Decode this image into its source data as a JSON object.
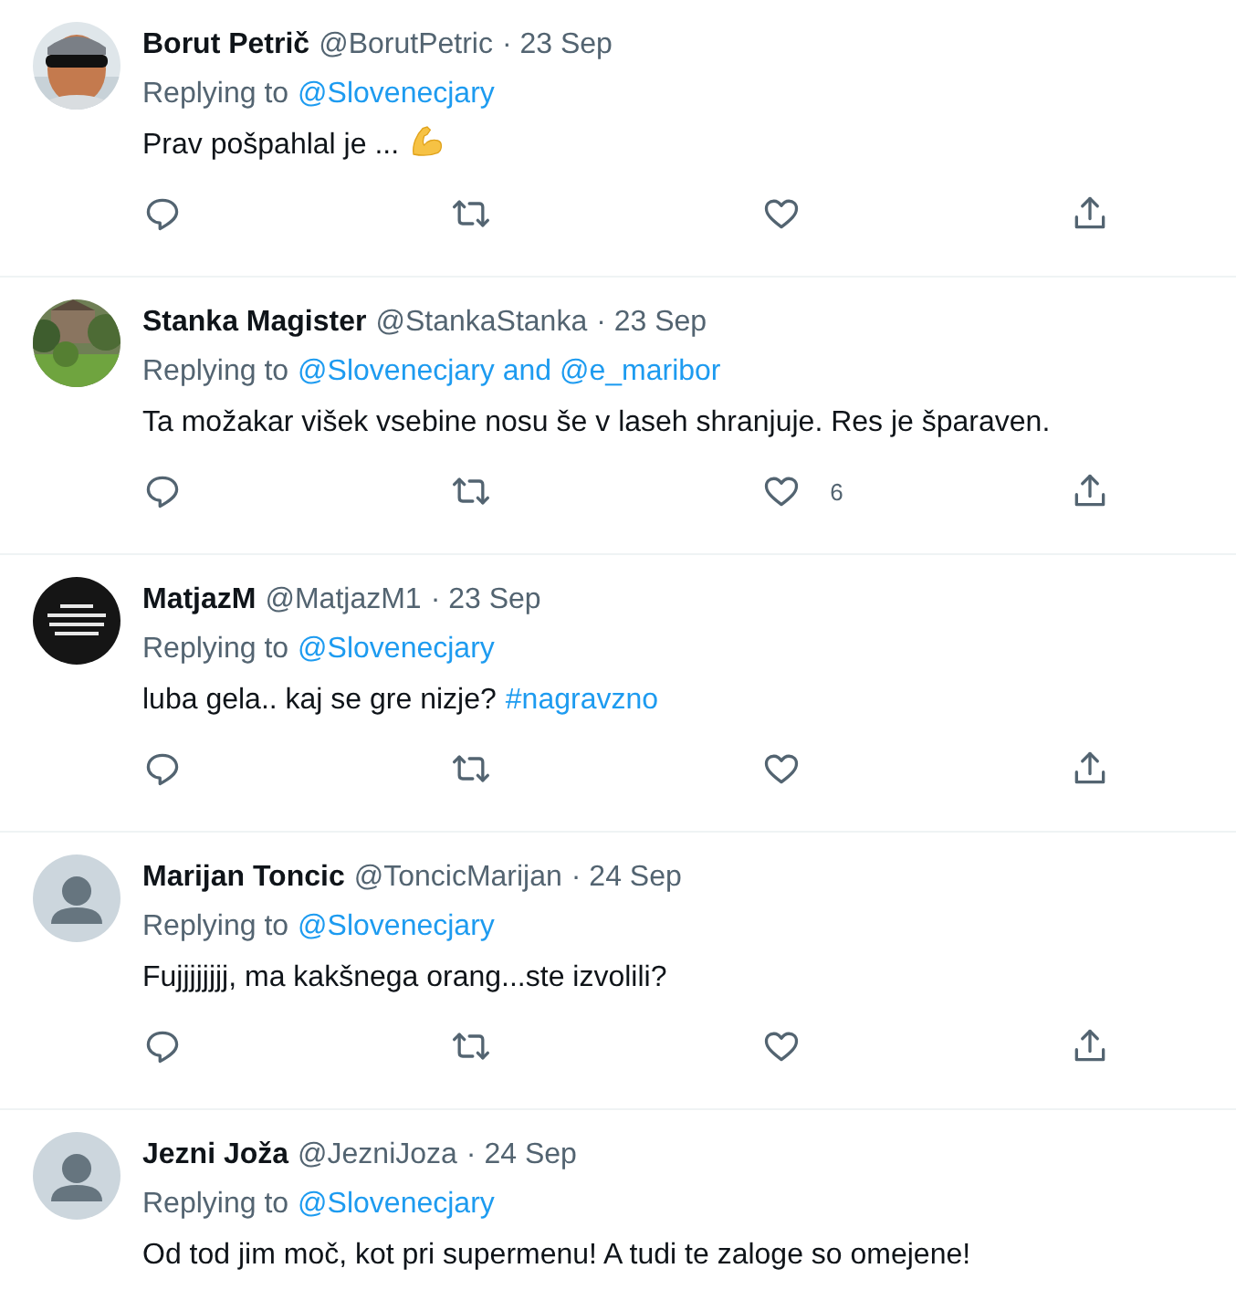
{
  "tweets": [
    {
      "avatar": {
        "kind": "photo-person"
      },
      "name": "Borut Petrič",
      "handle": "@BorutPetric",
      "date": "· 23 Sep",
      "replying_prefix": "Replying to",
      "replying_to": "@Slovenecjary",
      "body": [
        {
          "kind": "text",
          "text": "Prav pošpahlal je ..."
        },
        {
          "kind": "arm-emoji"
        }
      ],
      "actions_shown": true
    },
    {
      "avatar": {
        "kind": "photo-garden"
      },
      "name": "Stanka Magister",
      "handle": "@StankaStanka",
      "date": "· 23 Sep",
      "replying_prefix": "Replying to",
      "replying_to": "@Slovenecjary and @e_maribor",
      "body": [
        {
          "kind": "text",
          "text": "Ta možakar višek vsebine nosu še v laseh shranjuje. Res je šparaven."
        }
      ],
      "likes": "6",
      "actions_shown": true
    },
    {
      "avatar": {
        "kind": "photo-dark"
      },
      "name": "MatjazM",
      "handle": "@MatjazM1",
      "date": "· 23 Sep",
      "replying_prefix": "Replying to",
      "replying_to": "@Slovenecjary",
      "body": [
        {
          "kind": "text",
          "text": "luba gela.. kaj se gre nizje?"
        },
        {
          "kind": "hashtag",
          "text": "#nagravzno"
        }
      ],
      "actions_shown": true
    },
    {
      "avatar": {
        "kind": "default"
      },
      "name": "Marijan Toncic",
      "handle": "@ToncicMarijan",
      "date": "· 24 Sep",
      "replying_prefix": "Replying to",
      "replying_to": "@Slovenecjary",
      "body": [
        {
          "kind": "text",
          "text": "Fujjjjjjjj, ma kakšnega orang...ste izvolili?"
        }
      ],
      "actions_shown": true
    },
    {
      "avatar": {
        "kind": "default"
      },
      "name": "Jezni Joža",
      "handle": "@JezniJoza",
      "date": "· 24 Sep",
      "replying_prefix": "Replying to",
      "replying_to": "@Slovenecjary",
      "body": [
        {
          "kind": "text",
          "text": "Od tod jim moč, kot pri supermenu! A tudi te zaloge so omejene!"
        }
      ]
    }
  ]
}
